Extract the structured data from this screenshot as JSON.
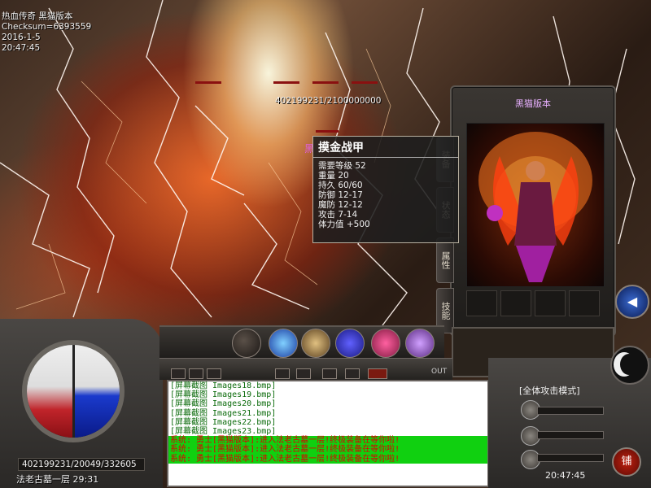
{
  "hud": {
    "game_title": "热血传奇 黑猫版本",
    "checksum": "Checksum=6393559",
    "date": "2016-1-5",
    "time": "20:47:45"
  },
  "target": {
    "hp_text": "402199231/2100000000",
    "name_partial": "黑"
  },
  "tooltip": {
    "item_name": "摸金战甲",
    "stats": [
      "需要等级 52",
      "重量 20",
      "持久 60/60",
      "防御 12-17",
      "魔防 12-12",
      "攻击 7-14",
      "体力值 +500"
    ]
  },
  "char_panel": {
    "title": "黑猫版本",
    "tabs": [
      "装备",
      "状态",
      "属性",
      "技能"
    ]
  },
  "player": {
    "hp_mp_text": "402199231/20049/332605",
    "location": "法老古墓一层 29:31"
  },
  "chat": {
    "lines": [
      "[屏幕截图  Images18.bmp]",
      "[屏幕截图  Images19.bmp]",
      "[屏幕截图  Images20.bmp]",
      "[屏幕截图  Images21.bmp]",
      "[屏幕截图  Images22.bmp]",
      "[屏幕截图  Images23.bmp]"
    ],
    "system_lines": [
      "系统: 勇士[黑猫版本]:进入法老古墓一层!终极装备在等你啦!",
      "系统: 勇士[黑猫版本]:进入法老古墓一层!终极装备在等你啦!",
      "系统: 勇士[黑猫版本]:进入法老古墓一层!终极装备在等你啦!"
    ],
    "out_label": "OUT"
  },
  "right_hud": {
    "attack_mode": "[全体攻击模式]",
    "clock": "20:47:45",
    "shop_label": "铺"
  },
  "colors": {
    "system_bg": "#10d010",
    "system_text": "#dd0000",
    "chat_text": "#0a6a0a",
    "hp_orb": "#c0242a",
    "mp_orb": "#1a3acc"
  }
}
